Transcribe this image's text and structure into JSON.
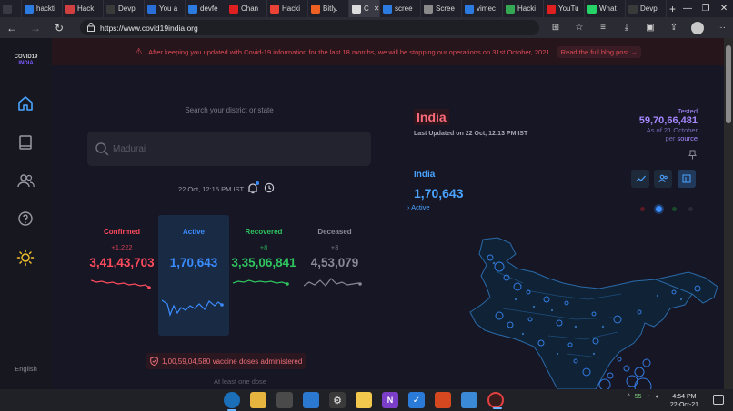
{
  "browser": {
    "tabs": [
      {
        "label": "",
        "icon": "tab-actions-icon",
        "color": "#3a3a44"
      },
      {
        "label": "hackti",
        "icon": "bing-icon",
        "color": "#2b7be0"
      },
      {
        "label": "Hack",
        "icon": "web-icon",
        "color": "#d04040"
      },
      {
        "label": "Devp",
        "icon": "devpost-icon",
        "color": "#3a3a3a"
      },
      {
        "label": "You a",
        "icon": "site-s-icon",
        "color": "#2a6fd8"
      },
      {
        "label": "devfe",
        "icon": "bing-icon",
        "color": "#2b7be0"
      },
      {
        "label": "Chan",
        "icon": "youtube-icon",
        "color": "#e02020"
      },
      {
        "label": "Hacki",
        "icon": "gmail-icon",
        "color": "#ea4335"
      },
      {
        "label": "Bitly.",
        "icon": "bitly-icon",
        "color": "#ee6123"
      },
      {
        "label": "C",
        "icon": "covid-icon",
        "color": "#dddddd",
        "active": true
      },
      {
        "label": "scree",
        "icon": "bing-icon",
        "color": "#2b7be0"
      },
      {
        "label": "Scree",
        "icon": "page-icon",
        "color": "#8a8a8a"
      },
      {
        "label": "vimec",
        "icon": "bing-icon",
        "color": "#2b7be0"
      },
      {
        "label": "Hacki",
        "icon": "google-drive-icon",
        "color": "#34a853"
      },
      {
        "label": "YouTu",
        "icon": "youtube-icon",
        "color": "#e02020"
      },
      {
        "label": "What",
        "icon": "whatsapp-icon",
        "color": "#25d366"
      },
      {
        "label": "Devp",
        "icon": "devpost-icon",
        "color": "#3a3a3a"
      }
    ],
    "url": "https://www.covid19india.org"
  },
  "banner": {
    "text": "After keeping you updated with Covid-19 information for the last 18 months, we will be stopping our operations on 31st October, 2021.",
    "link": "Read the full blog post →"
  },
  "sidebar": {
    "logo_line1": "COVID19",
    "logo_line2": "INDIA",
    "language": "English"
  },
  "search": {
    "label": "Search your district or state",
    "placeholder": "Madurai"
  },
  "timestamp": "22 Oct, 12:15 PM IST",
  "stats": [
    {
      "name": "Confirmed",
      "delta": "+1,222",
      "value": "3,41,43,703",
      "color": "#ff4b5c"
    },
    {
      "name": "Active",
      "delta": "",
      "value": "1,70,643",
      "color": "#3a8cff"
    },
    {
      "name": "Recovered",
      "delta": "+8",
      "value": "3,35,06,841",
      "color": "#2fc45e"
    },
    {
      "name": "Deceased",
      "delta": "+3",
      "value": "4,53,079",
      "color": "#8a8a96"
    }
  ],
  "vaccine": "1,00,59,04,580 vaccine doses administered",
  "dose_label": "At least one dose",
  "state": {
    "name": "India",
    "updated": "Last Updated on 22 Oct, 12:13 PM IST",
    "tested_label": "Tested",
    "tested_value": "59,70,66,481",
    "as_of": "As of 21 October",
    "per": "per",
    "source": "source"
  },
  "region": {
    "name": "India",
    "value": "1,70,643",
    "label": "Active"
  },
  "taskbar": {
    "time": "4:54 PM",
    "date": "22-Oct-21",
    "battery_pct": "55"
  },
  "colors": {
    "accent": "#3a8cff",
    "confirmed": "#ff4b5c",
    "recovered": "#2fc45e",
    "purple": "#a688ff"
  }
}
